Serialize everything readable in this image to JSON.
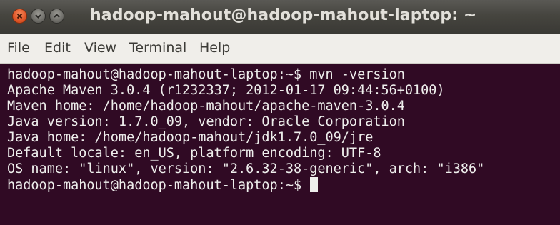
{
  "window": {
    "title": "hadoop-mahout@hadoop-mahout-laptop: ~",
    "buttons": {
      "close_icon": "close-icon",
      "minimize_icon": "minimize-icon",
      "maximize_icon": "maximize-icon"
    }
  },
  "menubar": {
    "items": [
      "File",
      "Edit",
      "View",
      "Terminal",
      "Help"
    ]
  },
  "terminal": {
    "lines": [
      "hadoop-mahout@hadoop-mahout-laptop:~$ mvn -version",
      "Apache Maven 3.0.4 (r1232337; 2012-01-17 09:44:56+0100)",
      "Maven home: /home/hadoop-mahout/apache-maven-3.0.4",
      "Java version: 1.7.0_09, vendor: Oracle Corporation",
      "Java home: /home/hadoop-mahout/jdk1.7.0_09/jre",
      "Default locale: en_US, platform encoding: UTF-8",
      "OS name: \"linux\", version: \"2.6.32-38-generic\", arch: \"i386\"",
      "hadoop-mahout@hadoop-mahout-laptop:~$ "
    ]
  },
  "colors": {
    "terminal_background": "#300a24",
    "terminal_foreground": "#eeeeec",
    "titlebar": "#46453f",
    "menubar": "#f0eeea",
    "close_button": "#e2582b"
  }
}
